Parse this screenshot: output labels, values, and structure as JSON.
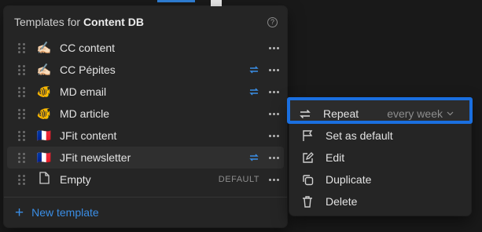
{
  "popup": {
    "title_prefix": "Templates for ",
    "title_db": "Content DB",
    "help_icon": "?",
    "templates": [
      {
        "label": "CC content",
        "emoji": "✍🏻",
        "repeat": false
      },
      {
        "label": "CC Pépites",
        "emoji": "✍🏻",
        "repeat": true
      },
      {
        "label": "MD email",
        "emoji": "🐠",
        "repeat": true
      },
      {
        "label": "MD article",
        "emoji": "🐠",
        "repeat": false
      },
      {
        "label": "JFit content",
        "emoji": "🇫🇷",
        "repeat": false
      },
      {
        "label": "JFit newsletter",
        "emoji": "🇫🇷",
        "repeat": true
      },
      {
        "label": "Empty",
        "emoji": "",
        "repeat": false,
        "badge": "DEFAULT"
      }
    ],
    "new_template_label": "New template",
    "plus_glyph": "+"
  },
  "menu": {
    "repeat_label": "Repeat",
    "repeat_value": "every week",
    "set_default_label": "Set as default",
    "edit_label": "Edit",
    "duplicate_label": "Duplicate",
    "delete_label": "Delete"
  },
  "colors": {
    "accent": "#3a8ee6",
    "highlight_border": "#1a6fe0",
    "panel": "#252525"
  }
}
